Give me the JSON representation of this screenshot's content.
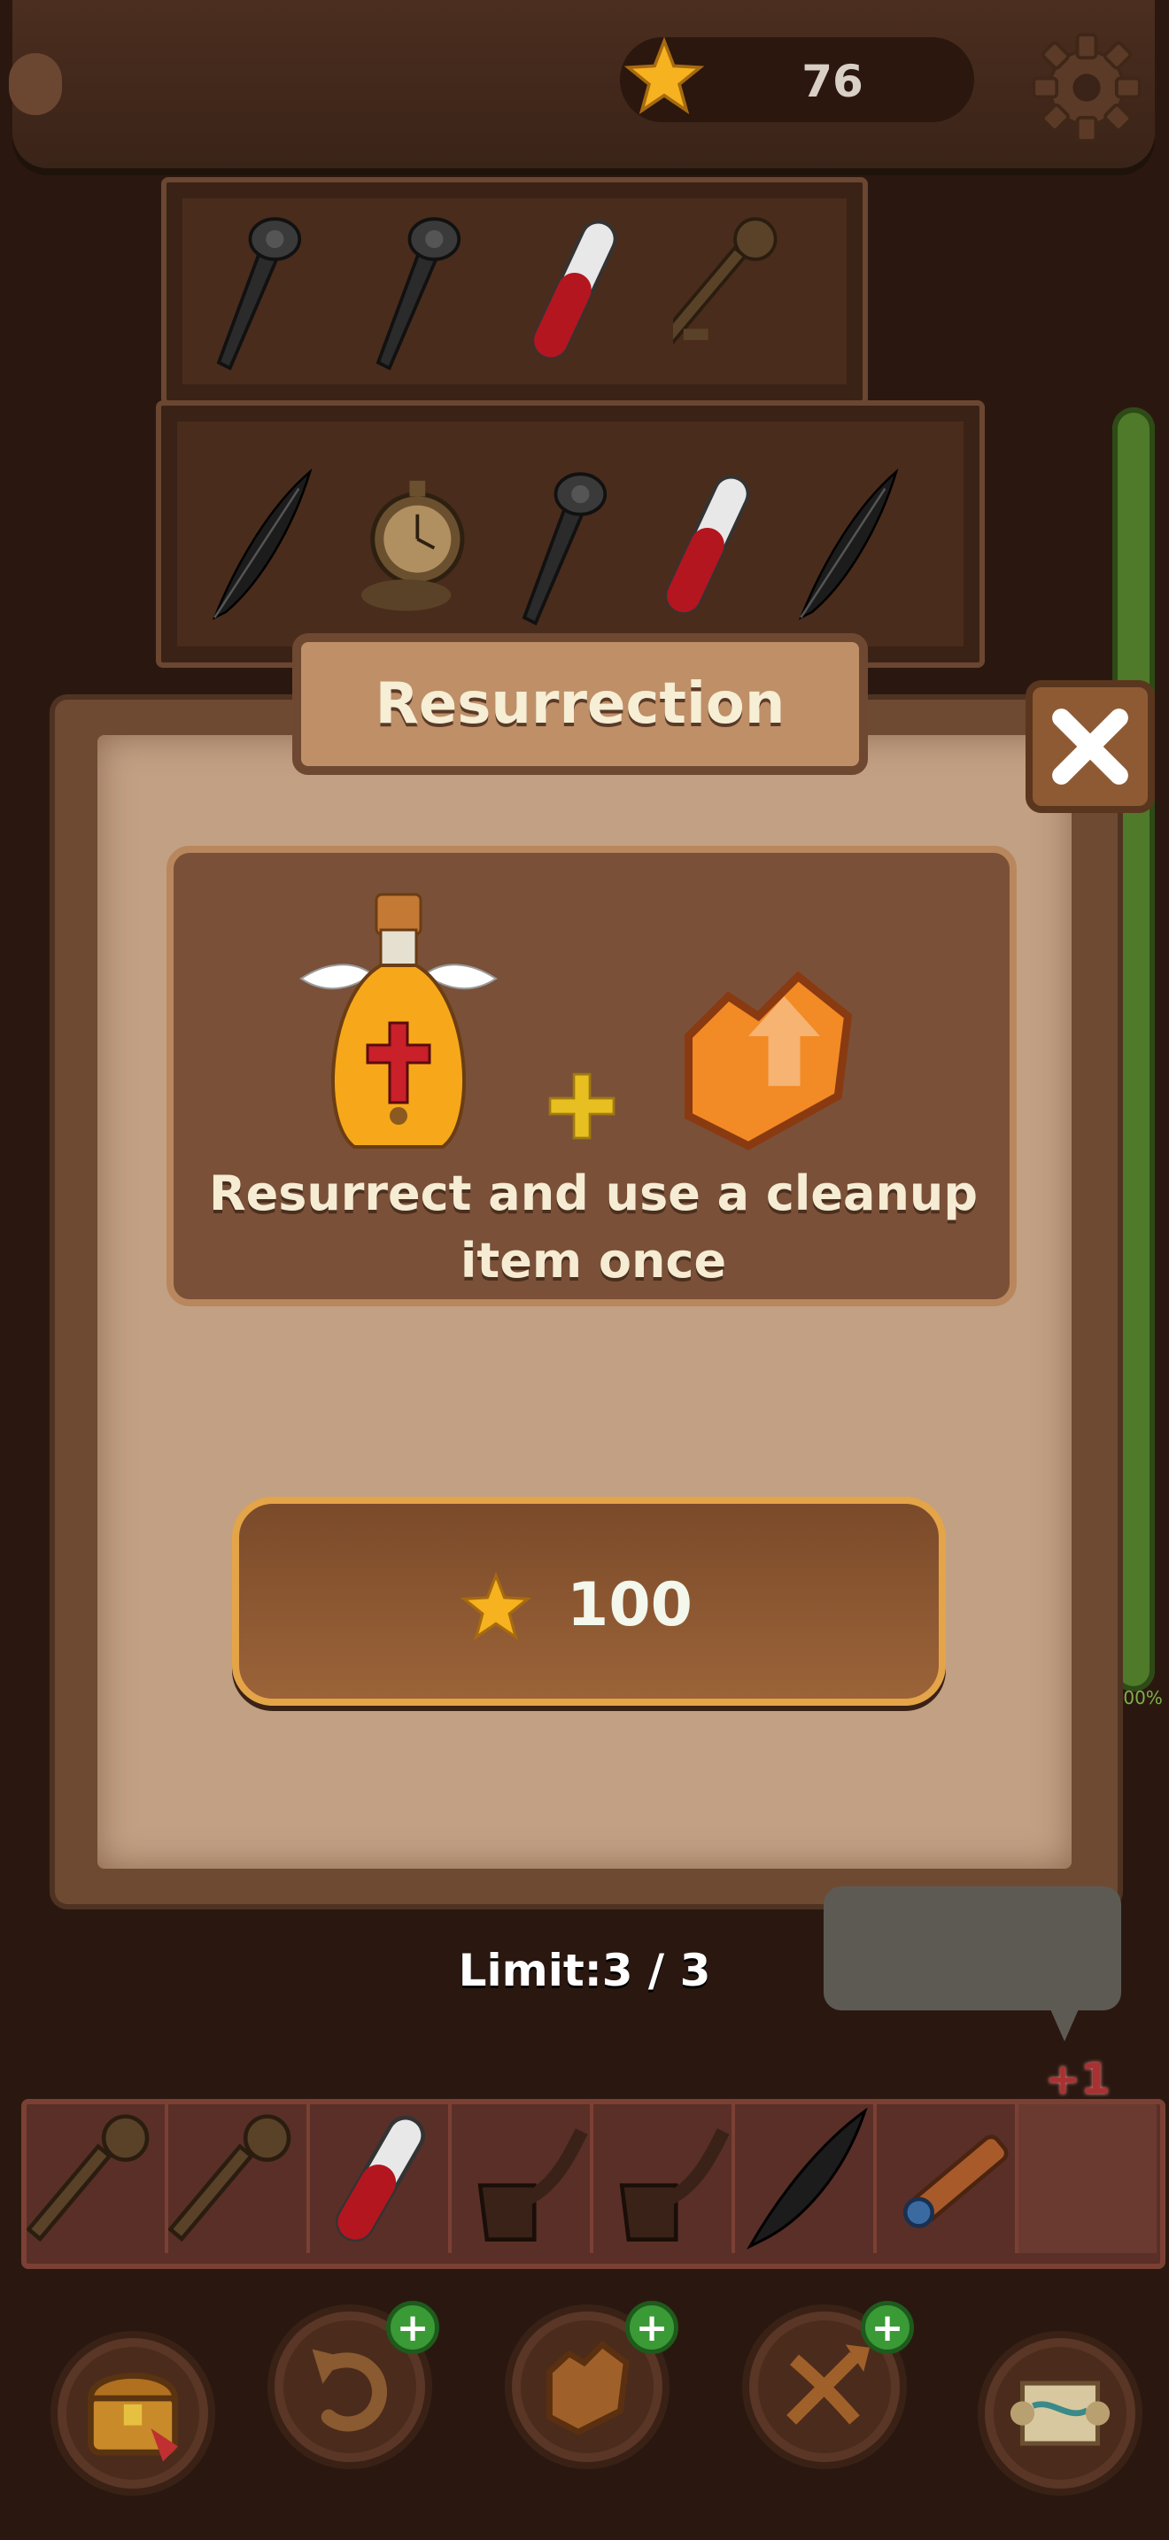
{
  "header": {
    "coins": "76"
  },
  "dialog": {
    "title": "Resurrection",
    "description": "Resurrect and use a cleanup item once",
    "price": "100"
  },
  "limit_text": "Limit:3 / 3",
  "tray": {
    "bonus_text": "+1",
    "items": [
      "key-icon",
      "key-icon",
      "blood-vial-icon",
      "pipe-icon",
      "pipe-icon",
      "feather-icon",
      "spyglass-icon",
      ""
    ]
  },
  "shelves": {
    "top": [
      "mace-icon",
      "mace-icon",
      "blood-vial-icon",
      "key-icon"
    ],
    "middle": [
      "feather-icon",
      "pocket-watch-icon",
      "mace-icon",
      "blood-vial-icon",
      "feather-icon"
    ]
  },
  "boosters": [
    {
      "icon": "treasure-chest-icon",
      "badge": false
    },
    {
      "icon": "undo-icon",
      "badge": true
    },
    {
      "icon": "cleanup-icon",
      "badge": true
    },
    {
      "icon": "shuffle-icon",
      "badge": true
    },
    {
      "icon": "map-scroll-icon",
      "badge": false
    }
  ],
  "side_progress_text": ".00%",
  "colors": {
    "star": "#f6b21f",
    "button_border": "#e4a448",
    "booster_badge": "#3a9a35"
  }
}
